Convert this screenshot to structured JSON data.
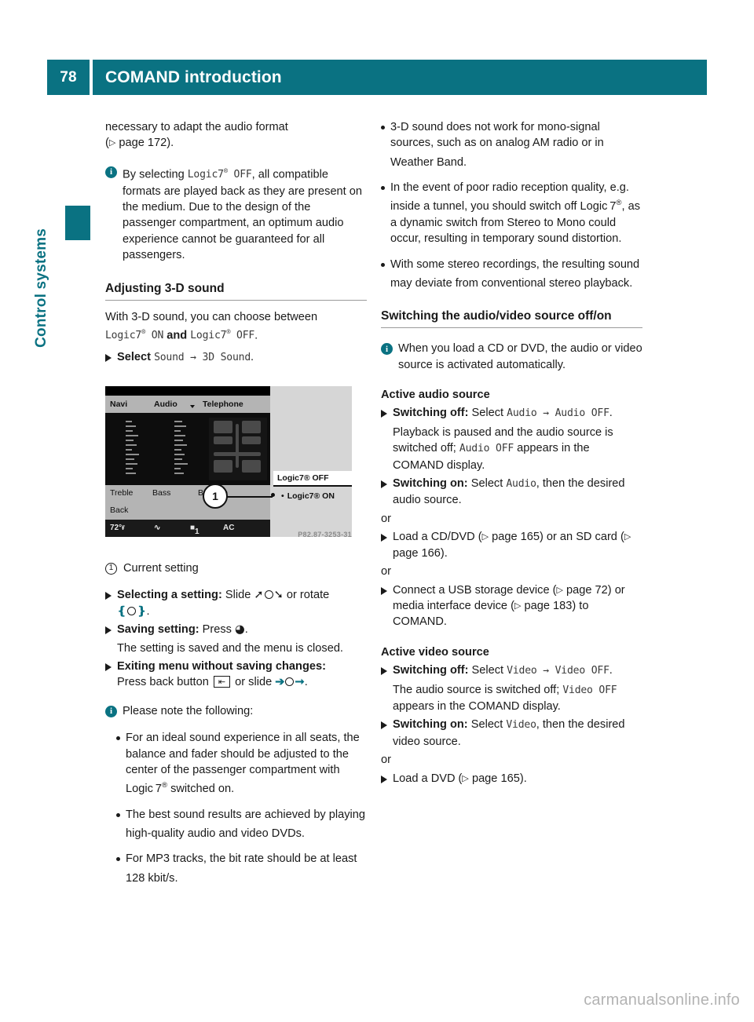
{
  "header": {
    "page_number": "78",
    "chapter_title": "COMAND introduction",
    "accent_color": "#0a7282"
  },
  "side_tab": {
    "label": "Control systems"
  },
  "left_column": {
    "continuation_paragraph": "necessary to adapt the audio format",
    "continuation_pageref_open": "(",
    "continuation_pageref": "page 172",
    "continuation_pageref_close": ").",
    "note_1": {
      "icon": "info-icon",
      "lead": "By selecting ",
      "mono_1": "Logic7",
      "mono_1_sup": "®",
      "mono_1_tail": " OFF",
      "body": ", all compatible formats are played back as they are present on the medium. Due to the design of the passenger compartment, an optimum audio experience cannot be guaranteed for all passengers."
    },
    "heading_3d": "Adjusting 3-D sound",
    "intro_3d": "With 3-D sound, you can choose between",
    "mono_on": "Logic7",
    "mono_on_sup": "®",
    "mono_on_tail": " ON",
    "and_word": " and ",
    "mono_off": "Logic7",
    "mono_off_sup": "®",
    "mono_off_tail": " OFF",
    "period": ".",
    "step_select_bold": "Select ",
    "step_select_mono_1": "Sound",
    "step_select_arrow": " → ",
    "step_select_mono_2": "3D Sound",
    "step_select_end": ".",
    "figure": {
      "menu_navi": "Navi",
      "menu_audio": "Audio",
      "menu_telephone": "Telephone",
      "label_treble": "Treble",
      "label_bass": "Bass",
      "label_balance": "Balance",
      "label_back": "Back",
      "status_temp": "72°ғ",
      "status_mode": "1",
      "status_ac": "AC",
      "popup_off": "Logic7® OFF",
      "popup_on": "Logic7® ON",
      "callout_number": "1",
      "code": "P82.87-3253-31"
    },
    "callout_1_num": "1",
    "callout_1_text": "Current setting",
    "step_selecting_bold": "Selecting a setting:",
    "step_selecting_text": " Slide ",
    "step_selecting_text_2": " or rotate",
    "step_selecting_cont_end": ".",
    "step_saving_bold": "Saving setting:",
    "step_saving_text": " Press ",
    "step_saving_end": ".",
    "step_saving_sub": "The setting is saved and the menu is closed.",
    "step_exiting_bold": "Exiting menu without saving changes:",
    "step_exiting_text": "Press back button ",
    "step_exiting_text_2": " or slide ",
    "step_exiting_end": ".",
    "note_2": {
      "icon": "info-icon",
      "text": "Please note the following:"
    },
    "bullets": [
      {
        "pre": "For an ideal sound experience in all seats, the balance and fader should be adjusted to the center of the passenger compartment with Logic 7",
        "sup": "®",
        "post": " switched on."
      },
      {
        "pre": "The best sound results are achieved by playing high-quality audio and video DVDs.",
        "sup": "",
        "post": ""
      },
      {
        "pre": "For MP3 tracks, the bit rate should be at least 128 kbit/s.",
        "sup": "",
        "post": ""
      }
    ]
  },
  "right_column": {
    "bullets_top": [
      {
        "pre": "3-D sound does not work for mono-signal sources, such as on analog AM radio or in Weather Band.",
        "sup": "",
        "post": ""
      },
      {
        "pre": "In the event of poor radio reception quality, e.g. inside a tunnel, you should switch off Logic 7",
        "sup": "®",
        "post": ", as a dynamic switch from Stereo to Mono could occur, resulting in temporary sound distortion."
      },
      {
        "pre": "With some stereo recordings, the resulting sound may deviate from conventional stereo playback.",
        "sup": "",
        "post": ""
      }
    ],
    "heading_switching": "Switching the audio/video source off/on",
    "note_load": {
      "icon": "info-icon",
      "text": "When you load a CD or DVD, the audio or video source is activated automatically."
    },
    "subheading_audio": "Active audio source",
    "audio_off_bold": "Switching off:",
    "audio_off_text": " Select ",
    "audio_off_mono_1": "Audio",
    "audio_off_arrow": " → ",
    "audio_off_mono_2": "Audio OFF",
    "audio_off_end": ".",
    "audio_off_sub_1": "Playback is paused and the audio source is switched off; ",
    "audio_off_sub_mono": "Audio OFF",
    "audio_off_sub_2": " appears in the COMAND display.",
    "audio_on_bold": "Switching on:",
    "audio_on_text": " Select ",
    "audio_on_mono": "Audio",
    "audio_on_end": ", then the desired audio source.",
    "or_1": "or",
    "load_cd_text": "Load a CD/DVD (",
    "load_cd_pageref": "page 165",
    "load_cd_mid": ") or an SD card (",
    "load_cd_pageref_2": "page 166",
    "load_cd_end": ").",
    "or_2": "or",
    "connect_usb_text": "Connect a USB storage device (",
    "connect_usb_pageref": "page 72",
    "connect_usb_mid": ") or media interface device (",
    "connect_usb_pageref_2": "page 183",
    "connect_usb_end": ") to COMAND.",
    "subheading_video": "Active video source",
    "video_off_bold": "Switching off:",
    "video_off_text": " Select ",
    "video_off_mono_1": "Video",
    "video_off_arrow": " → ",
    "video_off_mono_2": "Video OFF",
    "video_off_end": ".",
    "video_off_sub_1": "The audio source is switched off; ",
    "video_off_sub_mono": "Video OFF",
    "video_off_sub_2": " appears in the COMAND display.",
    "video_on_bold": "Switching on:",
    "video_on_text": " Select ",
    "video_on_mono": "Video",
    "video_on_end": ", then the desired video source.",
    "or_3": "or",
    "load_dvd_text": "Load a DVD (",
    "load_dvd_pageref": "page 165",
    "load_dvd_end": ")."
  },
  "watermark": "carmanualsonline.info"
}
